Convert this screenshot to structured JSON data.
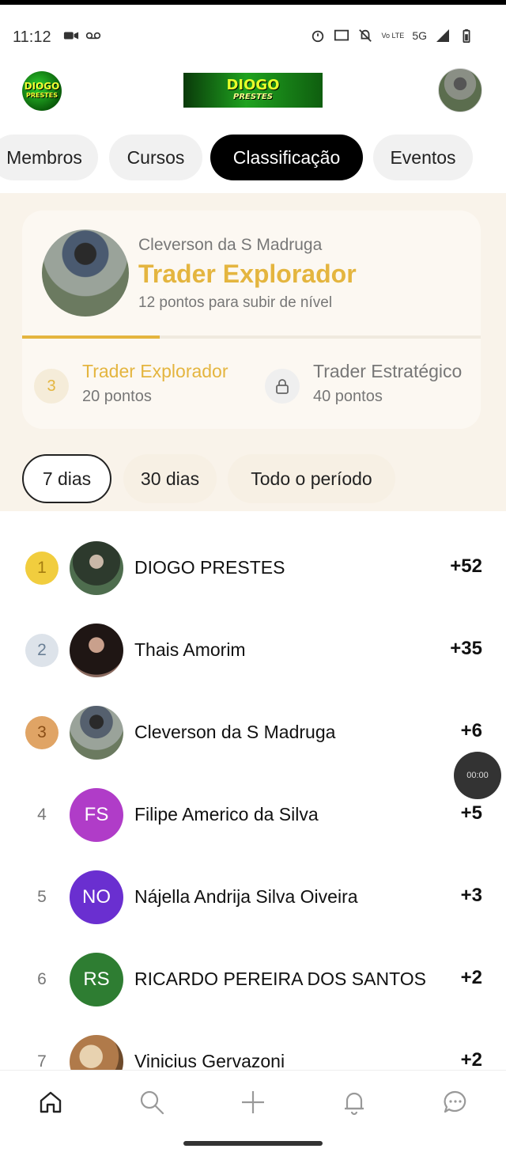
{
  "status_bar": {
    "time": "11:12",
    "network": "5G",
    "carrier_tag": "Vo LTE"
  },
  "header": {
    "logo_line1": "DIOGO",
    "logo_line2": "PRESTES"
  },
  "tabs": [
    {
      "label": "Membros",
      "active": false
    },
    {
      "label": "Cursos",
      "active": false
    },
    {
      "label": "Classificação",
      "active": true
    },
    {
      "label": "Eventos",
      "active": false
    }
  ],
  "profile": {
    "name": "Cleverson da S Madruga",
    "level_name": "Trader Explorador",
    "points_to_next": "12 pontos para subir de nível",
    "progress_fraction": 0.3,
    "current_level": {
      "number": "3",
      "name": "Trader Explorador",
      "points": "20 pontos"
    },
    "next_level": {
      "name": "Trader Estratégico",
      "points": "40 pontos",
      "icon": "lock-icon"
    }
  },
  "filters": [
    {
      "label": "7 dias",
      "active": true
    },
    {
      "label": "30 dias",
      "active": false
    },
    {
      "label": "Todo o período",
      "active": false
    }
  ],
  "leaderboard": [
    {
      "rank": "1",
      "name": "DIOGO PRESTES",
      "score": "+52",
      "initials": "",
      "avatar_color": "#3c4a3a"
    },
    {
      "rank": "2",
      "name": "Thais Amorim",
      "score": "+35",
      "initials": "",
      "avatar_color": "#2a1f1c"
    },
    {
      "rank": "3",
      "name": "Cleverson da S Madruga",
      "score": "+6",
      "initials": "",
      "avatar_color": "#7d8578"
    },
    {
      "rank": "4",
      "name": "Filipe Americo da Silva",
      "score": "+5",
      "initials": "FS",
      "avatar_color": "#b03cc8"
    },
    {
      "rank": "5",
      "name": "Nájella Andrija Silva Oiveira",
      "score": "+3",
      "initials": "NO",
      "avatar_color": "#6a2fd0"
    },
    {
      "rank": "6",
      "name": "RICARDO PEREIRA DOS SANTOS",
      "score": "+2",
      "initials": "RS",
      "avatar_color": "#2e7d32"
    },
    {
      "rank": "7",
      "name": "Vinicius Gervazoni",
      "score": "+2",
      "initials": "",
      "avatar_color": "#b07a4a"
    }
  ],
  "float_timer": "00:00",
  "bottom_nav": [
    {
      "icon": "home-icon"
    },
    {
      "icon": "search-icon"
    },
    {
      "icon": "plus-icon"
    },
    {
      "icon": "bell-icon"
    },
    {
      "icon": "chat-icon"
    }
  ],
  "colors": {
    "accent": "#e4b53f",
    "section_bg": "#f9f3ea"
  }
}
